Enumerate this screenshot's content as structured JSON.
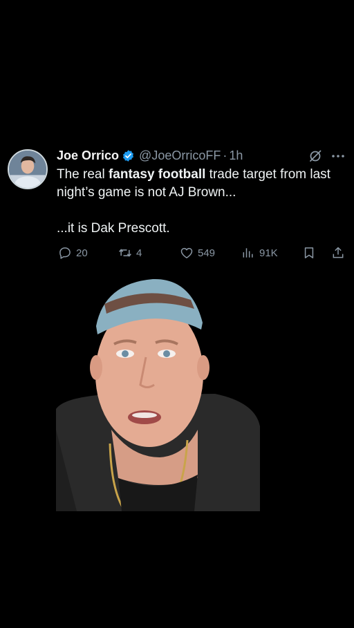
{
  "tweet": {
    "display_name": "Joe Orrico",
    "handle": "@JoeOrricoFF",
    "separator": "·",
    "time": "1h",
    "text": {
      "line1_prefix": "The real ",
      "line1_bold": "fantasy football",
      "line1_suffix": " trade target from last night’s game is not AJ Brown...",
      "line2": "...it is Dak Prescott."
    },
    "stats": {
      "replies": "20",
      "reposts": "4",
      "likes": "549",
      "views": "91K"
    }
  },
  "icons": {
    "verified": "verified-badge-icon",
    "grok": "grok-icon",
    "more": "more-dots-icon",
    "reply": "reply-icon",
    "repost": "repost-icon",
    "like": "heart-icon",
    "views": "views-icon",
    "bookmark": "bookmark-icon",
    "share": "share-icon"
  },
  "colors": {
    "background": "#000000",
    "text": "#eff3f4",
    "muted": "#8b98a5",
    "verified": "#1d9bf0"
  }
}
